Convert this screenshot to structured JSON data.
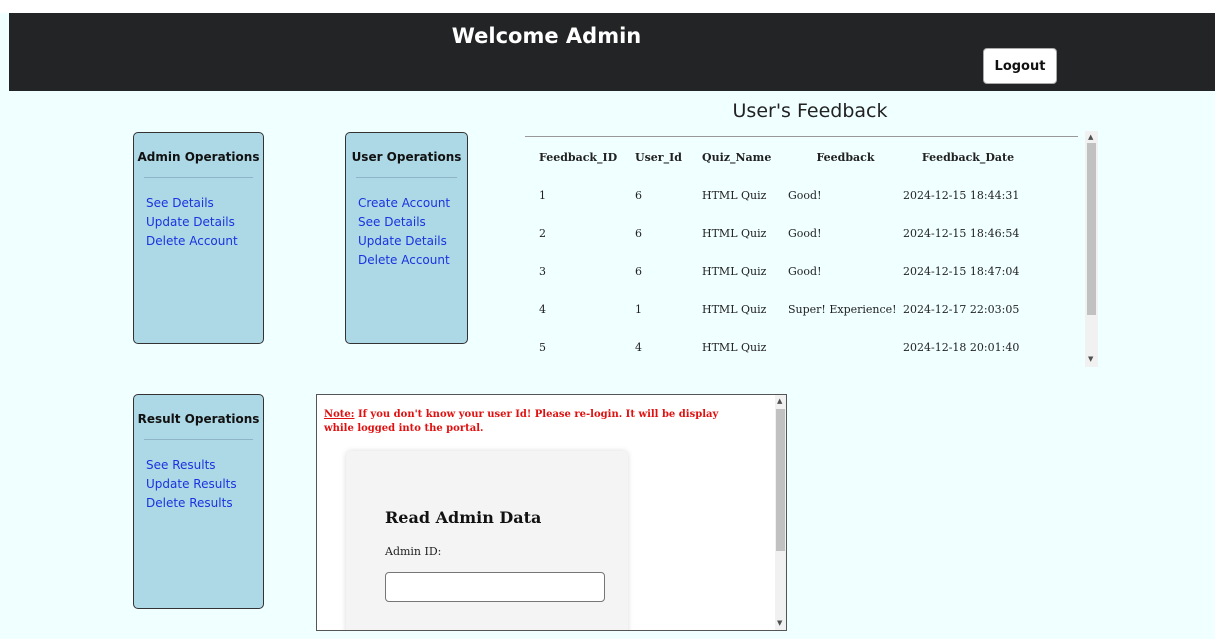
{
  "header": {
    "title": "Welcome Admin",
    "logout_label": "Logout"
  },
  "admin_ops": {
    "title": "Admin Operations",
    "links": [
      "See Details",
      "Update Details",
      "Delete Account"
    ]
  },
  "user_ops": {
    "title": "User Operations",
    "links": [
      "Create Account",
      "See Details",
      "Update Details",
      "Delete Account"
    ]
  },
  "result_ops": {
    "title": "Result Operations",
    "links": [
      "See Results",
      "Update Results",
      "Delete Results"
    ]
  },
  "feedback": {
    "title": "User's Feedback",
    "columns": [
      "Feedback_ID",
      "User_Id",
      "Quiz_Name",
      "Feedback",
      "Feedback_Date"
    ],
    "rows": [
      [
        "1",
        "6",
        "HTML Quiz",
        "Good!",
        "2024-12-15 18:44:31"
      ],
      [
        "2",
        "6",
        "HTML Quiz",
        "Good!",
        "2024-12-15 18:46:54"
      ],
      [
        "3",
        "6",
        "HTML Quiz",
        "Good!",
        "2024-12-15 18:47:04"
      ],
      [
        "4",
        "1",
        "HTML Quiz",
        "Super! Experience!",
        "2024-12-17 22:03:05"
      ],
      [
        "5",
        "4",
        "HTML Quiz",
        "",
        "2024-12-18 20:01:40"
      ]
    ]
  },
  "panel": {
    "note_label": "Note:",
    "note_text": " If you don't know your user Id! Please re-login. It will be display while logged into the portal.",
    "form_title": "Read Admin Data",
    "field_label": "Admin ID:",
    "field_value": ""
  }
}
